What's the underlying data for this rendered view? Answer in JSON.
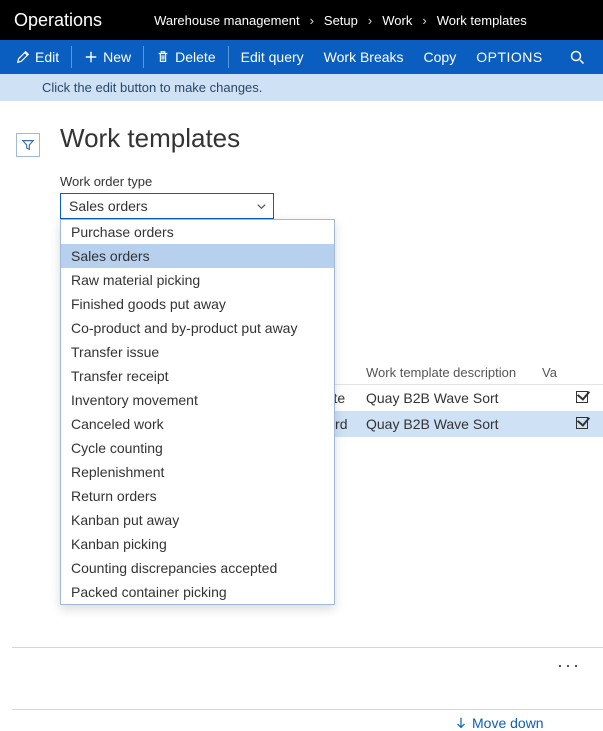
{
  "header": {
    "app_title": "Operations",
    "breadcrumb": [
      "Warehouse management",
      "Setup",
      "Work",
      "Work templates"
    ]
  },
  "toolbar": {
    "edit": "Edit",
    "new": "New",
    "delete": "Delete",
    "edit_query": "Edit query",
    "work_breaks": "Work Breaks",
    "copy": "Copy",
    "options": "OPTIONS"
  },
  "infobar": "Click the edit button to make changes.",
  "page": {
    "title": "Work templates",
    "field_label": "Work order type",
    "selected_value": "Sales orders",
    "options": [
      "Purchase orders",
      "Sales orders",
      "Raw material picking",
      "Finished goods put away",
      "Co-product and by-product put away",
      "Transfer issue",
      "Transfer receipt",
      "Inventory movement",
      "Canceled work",
      "Cycle counting",
      "Replenishment",
      "Return orders",
      "Kanban put away",
      "Kanban picking",
      "Counting discrepancies accepted",
      "Packed container picking"
    ]
  },
  "grid": {
    "columns": {
      "col_a": "",
      "col_b": "Work template description",
      "col_c": "Va"
    },
    "rows": [
      {
        "col_a": "xpedite",
        "col_b": "Quay B2B  Wave Sort",
        "checked": true,
        "selected": false
      },
      {
        "col_a": "tandard",
        "col_b": "Quay B2B  Wave Sort",
        "checked": true,
        "selected": true
      }
    ]
  },
  "actions": {
    "move_down": "Move down"
  }
}
